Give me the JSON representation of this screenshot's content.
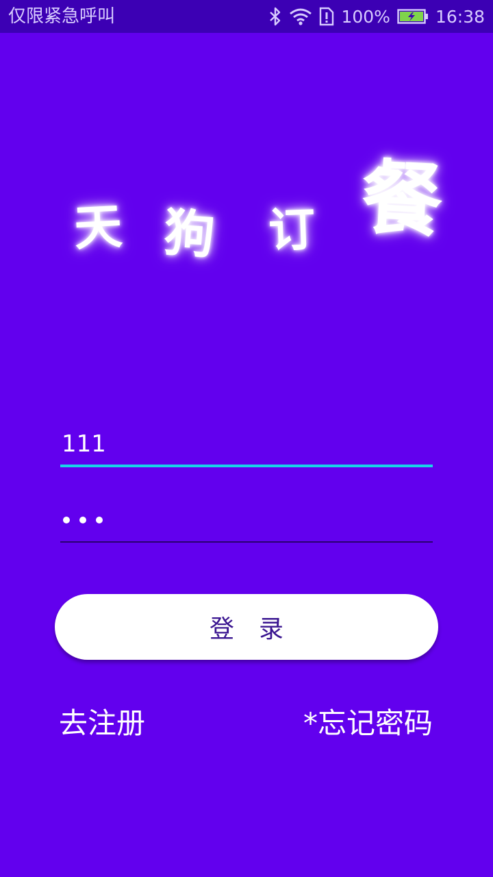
{
  "status_bar": {
    "left_text": "仅限紧急呼叫",
    "battery_percent": "100%",
    "time": "16:38",
    "icons": [
      "bluetooth-icon",
      "wifi-icon",
      "sim-alert-icon",
      "battery-charging-icon"
    ]
  },
  "logo": {
    "chars": [
      "天",
      "狗",
      "订",
      "餐"
    ]
  },
  "form": {
    "username_value": "111",
    "password_mask_count": 3
  },
  "login_button": {
    "label": "登录"
  },
  "links": {
    "register": "去注册",
    "forgot_password": "*忘记密码"
  },
  "colors": {
    "background": "#6200EE",
    "status_bar": "#3C00B4",
    "focus_underline": "#18D4E8",
    "button_text": "#3A1590"
  }
}
